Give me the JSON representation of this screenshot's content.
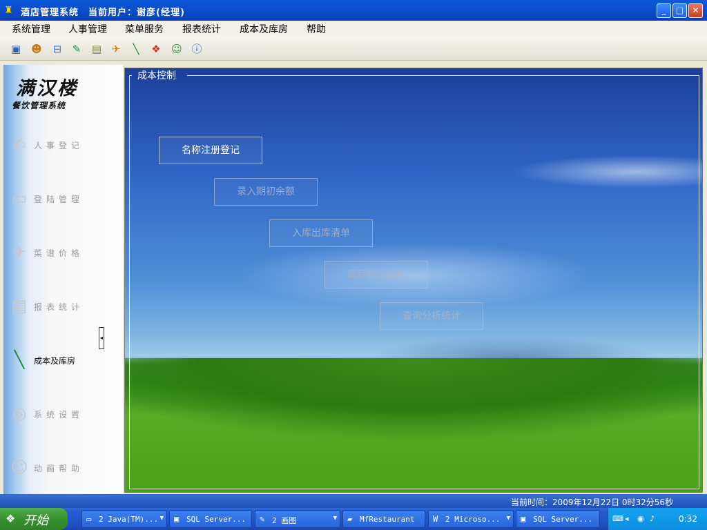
{
  "window": {
    "title": "酒店管理系统　当前用户：谢彦(经理)",
    "minimize_glyph": "_",
    "maximize_glyph": "□",
    "close_glyph": "✕"
  },
  "menu": [
    "系统管理",
    "人事管理",
    "菜单服务",
    "报表统计",
    "成本及库房",
    "帮助"
  ],
  "toolbar_icons": [
    "computer-icon",
    "users-icon",
    "network-icon",
    "chart-icon",
    "book-icon",
    "plane-icon",
    "feather-icon",
    "windows-icon",
    "headset-icon",
    "info-icon"
  ],
  "logo": {
    "title": "满汉楼",
    "subtitle": "餐饮管理系统"
  },
  "nav": [
    {
      "label": "人事登记",
      "icon": "person-icon"
    },
    {
      "label": "登陆管理",
      "icon": "monitor-icon"
    },
    {
      "label": "菜谱价格",
      "icon": "plane-icon"
    },
    {
      "label": "报表统计",
      "icon": "document-icon"
    },
    {
      "label": "成本及库房",
      "icon": "feather-icon",
      "active": true
    },
    {
      "label": "系统设置",
      "icon": "disc-icon"
    },
    {
      "label": "动画帮助",
      "icon": "headset-icon"
    }
  ],
  "main": {
    "group_label": "成本控制",
    "buttons": [
      "名称注册登记",
      "录入期初余额",
      "入库出库清单",
      "库存统计盘点",
      "查询分析统计"
    ]
  },
  "status": {
    "text": "当前时间：2009年12月22日 0时32分56秒"
  },
  "taskbar": {
    "start": "开始",
    "tasks": [
      "2 Java(TM)...",
      "SQL Server...",
      "2 画图",
      "MfRestaurant",
      "2 Microso...",
      "SQL Server..."
    ],
    "clock": "0:32"
  }
}
